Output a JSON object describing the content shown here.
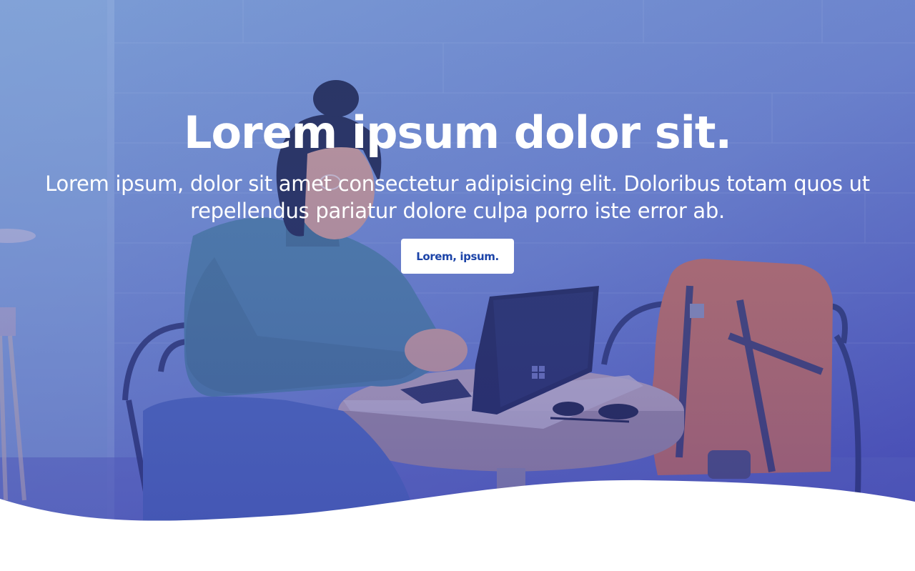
{
  "hero": {
    "title": "Lorem ipsum dolor sit.",
    "subtitle": "Lorem ipsum, dolor sit amet consectetur adipisicing elit. Doloribus totam quos ut repellendus pariatur dolore culpa porro iste error ab.",
    "cta_label": "Lorem, ipsum."
  },
  "colors": {
    "overlay": "#4d68c6",
    "cta_text": "#1c44a8",
    "background": "#ffffff"
  }
}
